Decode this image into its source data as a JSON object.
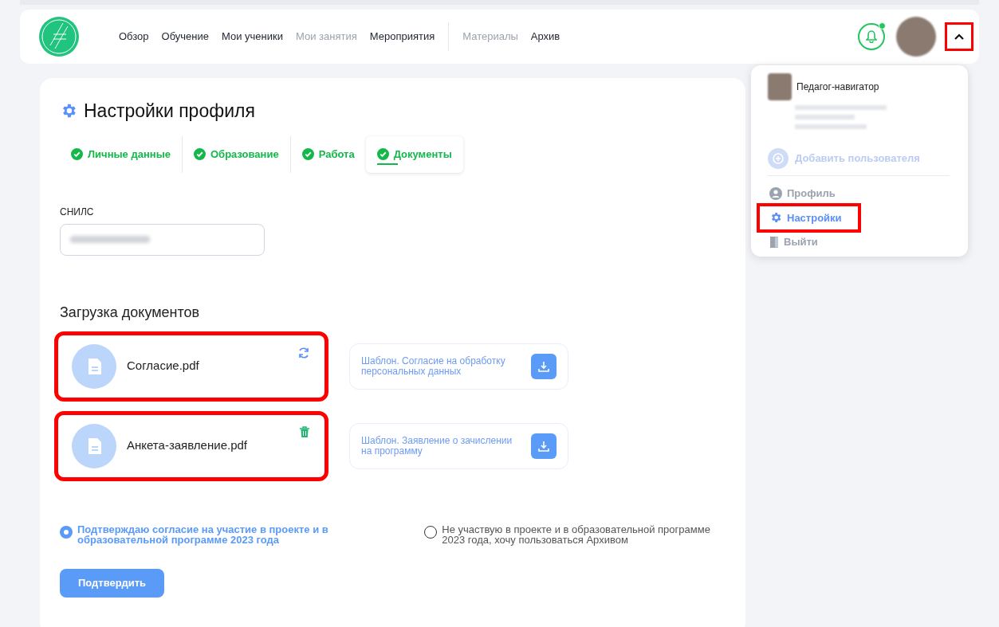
{
  "nav": {
    "groups": [
      [
        {
          "label": "Обзор",
          "disabled": false
        },
        {
          "label": "Обучение",
          "disabled": false
        },
        {
          "label": "Мои ученики",
          "disabled": false
        },
        {
          "label": "Мои занятия",
          "disabled": true
        },
        {
          "label": "Мероприятия",
          "disabled": false
        }
      ],
      [
        {
          "label": "Материалы",
          "disabled": true
        },
        {
          "label": "Архив",
          "disabled": false
        }
      ]
    ],
    "notifications": {
      "unread": true
    },
    "menu_toggle": {
      "expanded": true,
      "highlighted": true
    }
  },
  "user_menu": {
    "role": "Педагог-навигатор",
    "add_user": {
      "label": "Добавить пользователя",
      "disabled": true
    },
    "items": [
      {
        "kind": "profile",
        "label": "Профиль",
        "selected": false,
        "highlighted": false
      },
      {
        "kind": "settings",
        "label": "Настройки",
        "selected": true,
        "highlighted": true
      },
      {
        "kind": "logout",
        "label": "Выйти",
        "selected": false,
        "highlighted": false
      }
    ]
  },
  "page": {
    "title": "Настройки профиля",
    "tabs": [
      {
        "label": "Личные данные",
        "done": true,
        "selected": false
      },
      {
        "label": "Образование",
        "done": true,
        "selected": false
      },
      {
        "label": "Работа",
        "done": true,
        "selected": false
      },
      {
        "label": "Документы",
        "done": true,
        "selected": true
      }
    ],
    "snils": {
      "label": "СНИЛС"
    },
    "documents_title": "Загрузка документов",
    "documents": [
      {
        "file": "Согласие.pdf",
        "kind": "replace",
        "highlighted": true,
        "template": "Шаблон. Согласие на обработку персональных данных"
      },
      {
        "file": "Анкета-заявление.pdf",
        "kind": "delete",
        "highlighted": true,
        "template": "Шаблон. Заявление о зачислении на программу"
      }
    ],
    "options": [
      {
        "label": "Подтверждаю согласие на участие в проекте и в образовательной программе 2023 года",
        "selected": true
      },
      {
        "label": "Не участвую в проекте и в образовательной программе 2023 года, хочу пользоваться Архивом",
        "selected": false
      }
    ],
    "submit": "Подтвердить"
  }
}
